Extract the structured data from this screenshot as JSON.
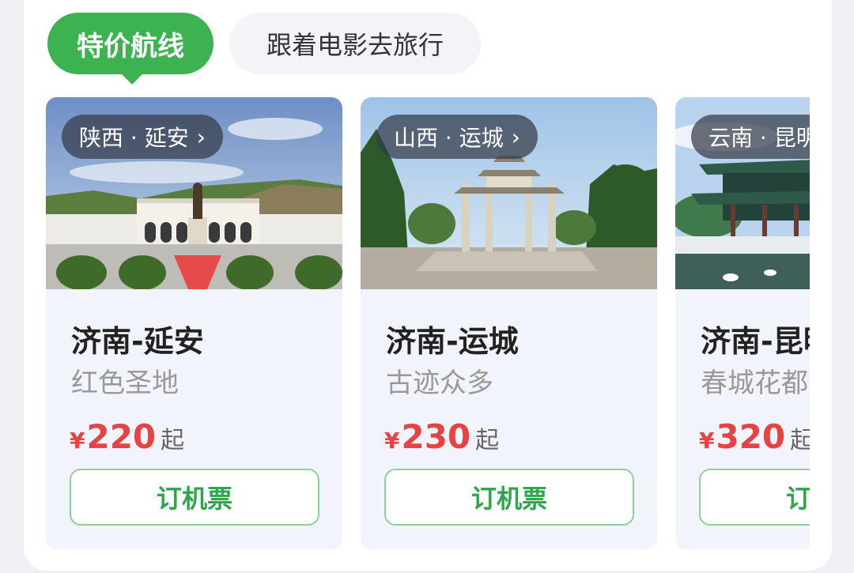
{
  "tabs": [
    {
      "label": "特价航线",
      "active": true
    },
    {
      "label": "跟着电影去旅行",
      "active": false
    }
  ],
  "colors": {
    "accent": "#3db250",
    "price": "#e84242"
  },
  "cards": [
    {
      "location": "陕西 · 延安",
      "route": "济南-延安",
      "tagline": "红色圣地",
      "currency": "¥",
      "price": "220",
      "from": "起",
      "button": "订机票"
    },
    {
      "location": "山西 · 运城",
      "route": "济南-运城",
      "tagline": "古迹众多",
      "currency": "¥",
      "price": "230",
      "from": "起",
      "button": "订机票"
    },
    {
      "location": "云南 · 昆明",
      "route": "济南-昆明",
      "tagline": "春城花都",
      "currency": "¥",
      "price": "320",
      "from": "起",
      "button": "订机票"
    }
  ]
}
